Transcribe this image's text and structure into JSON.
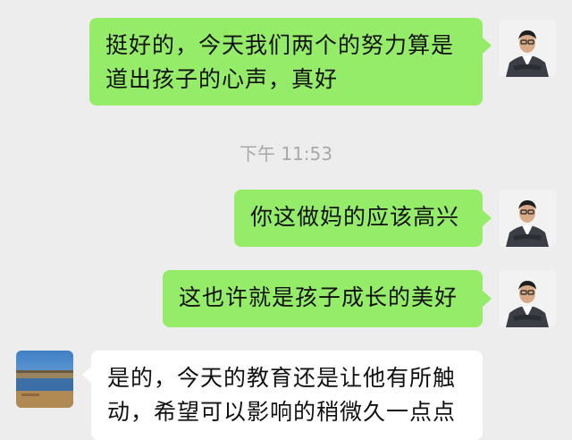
{
  "messages": [
    {
      "side": "right",
      "lines": [
        "挺好的，今天我们两个的努力算是",
        "道出孩子的心声，真好"
      ]
    },
    {
      "side": "right",
      "lines": [
        "你这做妈的应该高兴"
      ]
    },
    {
      "side": "right",
      "lines": [
        "这也许就是孩子成长的美好"
      ]
    },
    {
      "side": "left",
      "lines": [
        "是的，今天的教育还是让他有所触",
        "动，希望可以影响的稍微久一点点"
      ]
    }
  ],
  "timestamp": "下午 11:53",
  "colors": {
    "outgoing_bubble": "#95ec69",
    "incoming_bubble": "#ffffff",
    "background": "#ededed",
    "timestamp": "#a8a8a8"
  }
}
